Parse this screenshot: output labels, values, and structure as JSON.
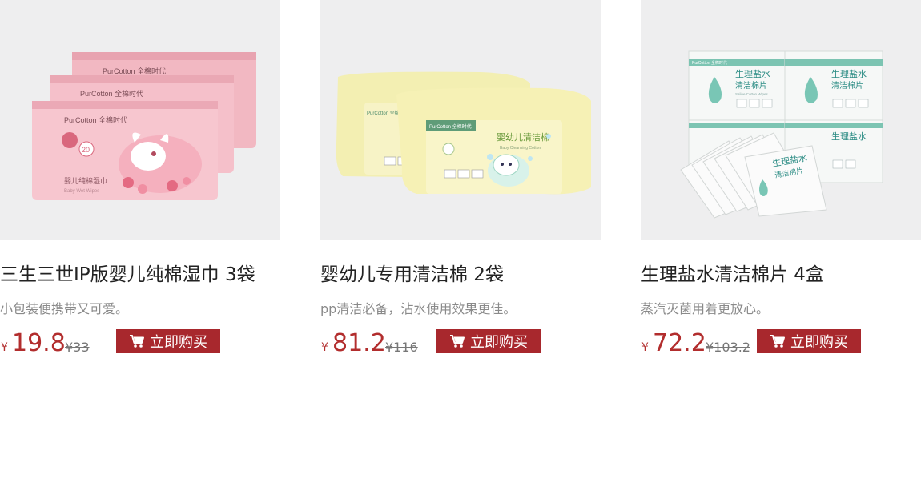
{
  "products": [
    {
      "title": "三生三世IP版婴儿纯棉湿巾 3袋",
      "desc": "小包装便携带又可爱。",
      "currency": "¥",
      "price": "19.8",
      "original_price": "¥33",
      "buy_label": "立即购买",
      "package_brand": "PurCotton 全棉时代",
      "package_name": "婴儿纯棉湿巾",
      "package_sub": "Baby Wet Wipes",
      "package_count": "20"
    },
    {
      "title": "婴幼儿专用清洁棉 2袋",
      "desc": "pp清洁必备，沾水使用效果更佳。",
      "currency": "¥",
      "price": "81.2",
      "original_price": "¥116",
      "buy_label": "立即购买",
      "package_brand": "PurCotton 全棉时代",
      "package_name": "婴幼儿清洁棉",
      "package_sub": "Baby Cleansing Cotton"
    },
    {
      "title": "生理盐水清洁棉片 4盒",
      "desc": "蒸汽灭菌用着更放心。",
      "currency": "¥",
      "price": "72.2",
      "original_price": "¥103.2",
      "buy_label": "立即购买",
      "package_brand": "PurCotton 全棉时代",
      "package_name": "生理盐水",
      "package_name2": "清洁棉片",
      "package_sub": "Saline Cotton Wipes"
    }
  ],
  "colors": {
    "price": "#b22d2d",
    "button": "#a8282d",
    "image_bg": "#eeeeef"
  },
  "icons": {
    "cart": "cart-icon"
  }
}
